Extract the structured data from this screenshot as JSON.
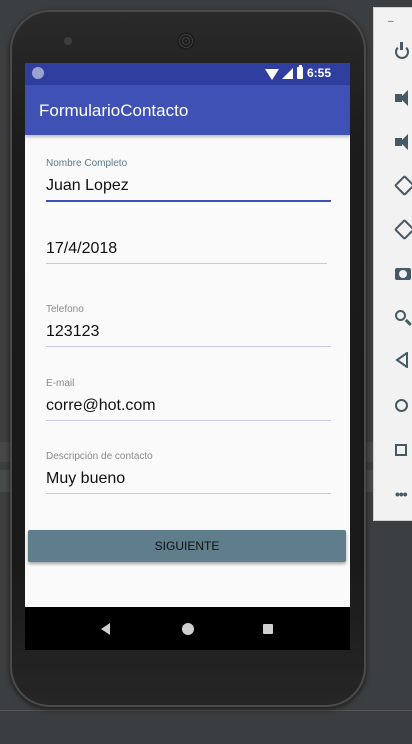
{
  "status": {
    "time": "6:55"
  },
  "app": {
    "title": "FormularioContacto"
  },
  "form": {
    "name": {
      "label": "Nombre Completo",
      "value": "Juan Lopez"
    },
    "date": {
      "value": "17/4/2018"
    },
    "phone": {
      "label": "Telefono",
      "value": "123123"
    },
    "email": {
      "label": "E-mail",
      "value": "corre@hot.com"
    },
    "description": {
      "label": "Descripción de contacto",
      "value": "Muy bueno"
    },
    "next_button": "SIGUIENTE"
  },
  "emulator_panel": {
    "minimize": "–",
    "icons": [
      "power-icon",
      "volume-up-icon",
      "volume-down-icon",
      "rotate-left-icon",
      "rotate-right-icon",
      "camera-icon",
      "zoom-icon",
      "back-icon",
      "home-icon",
      "overview-icon",
      "more-icon"
    ]
  },
  "colors": {
    "status_bar": "#303f9f",
    "app_bar": "#3f51b5",
    "button": "#607d8b",
    "field_focus": "#3f51b5"
  }
}
